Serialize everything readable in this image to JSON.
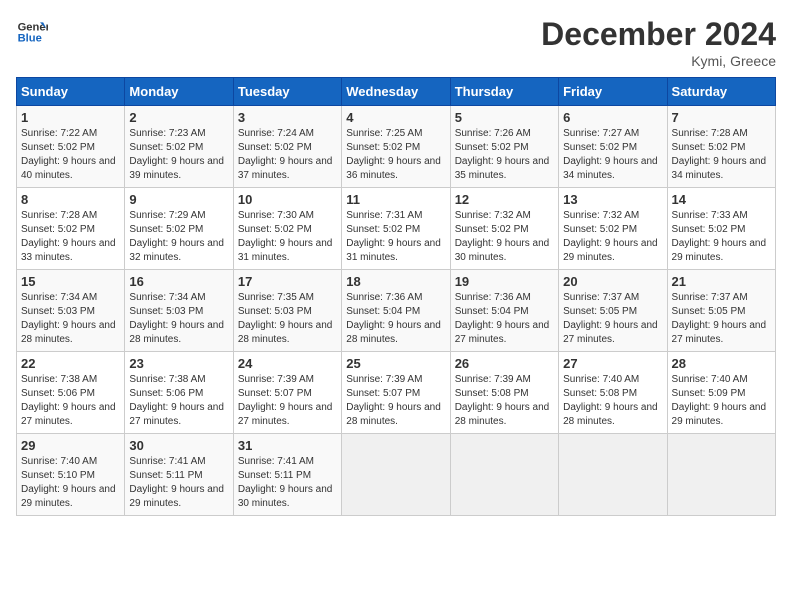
{
  "header": {
    "logo_general": "General",
    "logo_blue": "Blue",
    "month_title": "December 2024",
    "location": "Kymi, Greece"
  },
  "weekdays": [
    "Sunday",
    "Monday",
    "Tuesday",
    "Wednesday",
    "Thursday",
    "Friday",
    "Saturday"
  ],
  "weeks": [
    [
      {
        "day": "1",
        "sunrise": "7:22 AM",
        "sunset": "5:02 PM",
        "daylight": "9 hours and 40 minutes."
      },
      {
        "day": "2",
        "sunrise": "7:23 AM",
        "sunset": "5:02 PM",
        "daylight": "9 hours and 39 minutes."
      },
      {
        "day": "3",
        "sunrise": "7:24 AM",
        "sunset": "5:02 PM",
        "daylight": "9 hours and 37 minutes."
      },
      {
        "day": "4",
        "sunrise": "7:25 AM",
        "sunset": "5:02 PM",
        "daylight": "9 hours and 36 minutes."
      },
      {
        "day": "5",
        "sunrise": "7:26 AM",
        "sunset": "5:02 PM",
        "daylight": "9 hours and 35 minutes."
      },
      {
        "day": "6",
        "sunrise": "7:27 AM",
        "sunset": "5:02 PM",
        "daylight": "9 hours and 34 minutes."
      },
      {
        "day": "7",
        "sunrise": "7:28 AM",
        "sunset": "5:02 PM",
        "daylight": "9 hours and 34 minutes."
      }
    ],
    [
      {
        "day": "8",
        "sunrise": "7:28 AM",
        "sunset": "5:02 PM",
        "daylight": "9 hours and 33 minutes."
      },
      {
        "day": "9",
        "sunrise": "7:29 AM",
        "sunset": "5:02 PM",
        "daylight": "9 hours and 32 minutes."
      },
      {
        "day": "10",
        "sunrise": "7:30 AM",
        "sunset": "5:02 PM",
        "daylight": "9 hours and 31 minutes."
      },
      {
        "day": "11",
        "sunrise": "7:31 AM",
        "sunset": "5:02 PM",
        "daylight": "9 hours and 31 minutes."
      },
      {
        "day": "12",
        "sunrise": "7:32 AM",
        "sunset": "5:02 PM",
        "daylight": "9 hours and 30 minutes."
      },
      {
        "day": "13",
        "sunrise": "7:32 AM",
        "sunset": "5:02 PM",
        "daylight": "9 hours and 29 minutes."
      },
      {
        "day": "14",
        "sunrise": "7:33 AM",
        "sunset": "5:02 PM",
        "daylight": "9 hours and 29 minutes."
      }
    ],
    [
      {
        "day": "15",
        "sunrise": "7:34 AM",
        "sunset": "5:03 PM",
        "daylight": "9 hours and 28 minutes."
      },
      {
        "day": "16",
        "sunrise": "7:34 AM",
        "sunset": "5:03 PM",
        "daylight": "9 hours and 28 minutes."
      },
      {
        "day": "17",
        "sunrise": "7:35 AM",
        "sunset": "5:03 PM",
        "daylight": "9 hours and 28 minutes."
      },
      {
        "day": "18",
        "sunrise": "7:36 AM",
        "sunset": "5:04 PM",
        "daylight": "9 hours and 28 minutes."
      },
      {
        "day": "19",
        "sunrise": "7:36 AM",
        "sunset": "5:04 PM",
        "daylight": "9 hours and 27 minutes."
      },
      {
        "day": "20",
        "sunrise": "7:37 AM",
        "sunset": "5:05 PM",
        "daylight": "9 hours and 27 minutes."
      },
      {
        "day": "21",
        "sunrise": "7:37 AM",
        "sunset": "5:05 PM",
        "daylight": "9 hours and 27 minutes."
      }
    ],
    [
      {
        "day": "22",
        "sunrise": "7:38 AM",
        "sunset": "5:06 PM",
        "daylight": "9 hours and 27 minutes."
      },
      {
        "day": "23",
        "sunrise": "7:38 AM",
        "sunset": "5:06 PM",
        "daylight": "9 hours and 27 minutes."
      },
      {
        "day": "24",
        "sunrise": "7:39 AM",
        "sunset": "5:07 PM",
        "daylight": "9 hours and 27 minutes."
      },
      {
        "day": "25",
        "sunrise": "7:39 AM",
        "sunset": "5:07 PM",
        "daylight": "9 hours and 28 minutes."
      },
      {
        "day": "26",
        "sunrise": "7:39 AM",
        "sunset": "5:08 PM",
        "daylight": "9 hours and 28 minutes."
      },
      {
        "day": "27",
        "sunrise": "7:40 AM",
        "sunset": "5:08 PM",
        "daylight": "9 hours and 28 minutes."
      },
      {
        "day": "28",
        "sunrise": "7:40 AM",
        "sunset": "5:09 PM",
        "daylight": "9 hours and 29 minutes."
      }
    ],
    [
      {
        "day": "29",
        "sunrise": "7:40 AM",
        "sunset": "5:10 PM",
        "daylight": "9 hours and 29 minutes."
      },
      {
        "day": "30",
        "sunrise": "7:41 AM",
        "sunset": "5:11 PM",
        "daylight": "9 hours and 29 minutes."
      },
      {
        "day": "31",
        "sunrise": "7:41 AM",
        "sunset": "5:11 PM",
        "daylight": "9 hours and 30 minutes."
      },
      null,
      null,
      null,
      null
    ]
  ]
}
